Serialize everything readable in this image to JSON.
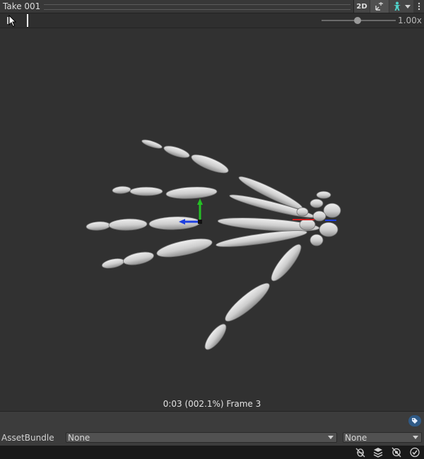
{
  "titlebar": {
    "title": "Take 001",
    "btn_2d": "2D",
    "pivot_icon": "pivot-icon",
    "avatar_icon": "avatar-icon",
    "menu_icon": "kebab-menu-icon"
  },
  "controls": {
    "play_icon": "pause-icon",
    "speed": 0.5,
    "speed_label": "1.00x"
  },
  "viewport": {
    "frame_info": "0:03 (002.1%) Frame 3",
    "gizmo_colors": {
      "y": "#25c025",
      "x": "#1d3fe0",
      "z": "#d02020"
    }
  },
  "assetbundle": {
    "label": "AssetBundle",
    "bundle_value": "None",
    "variant_value": "None",
    "tag_icon": "tag-icon"
  },
  "statusbar": {
    "icons": [
      "debug-icon",
      "layers-icon",
      "network-icon",
      "check-icon"
    ]
  },
  "colors": {
    "accent": "#2f5a86",
    "bone": "#d6d6d6"
  }
}
